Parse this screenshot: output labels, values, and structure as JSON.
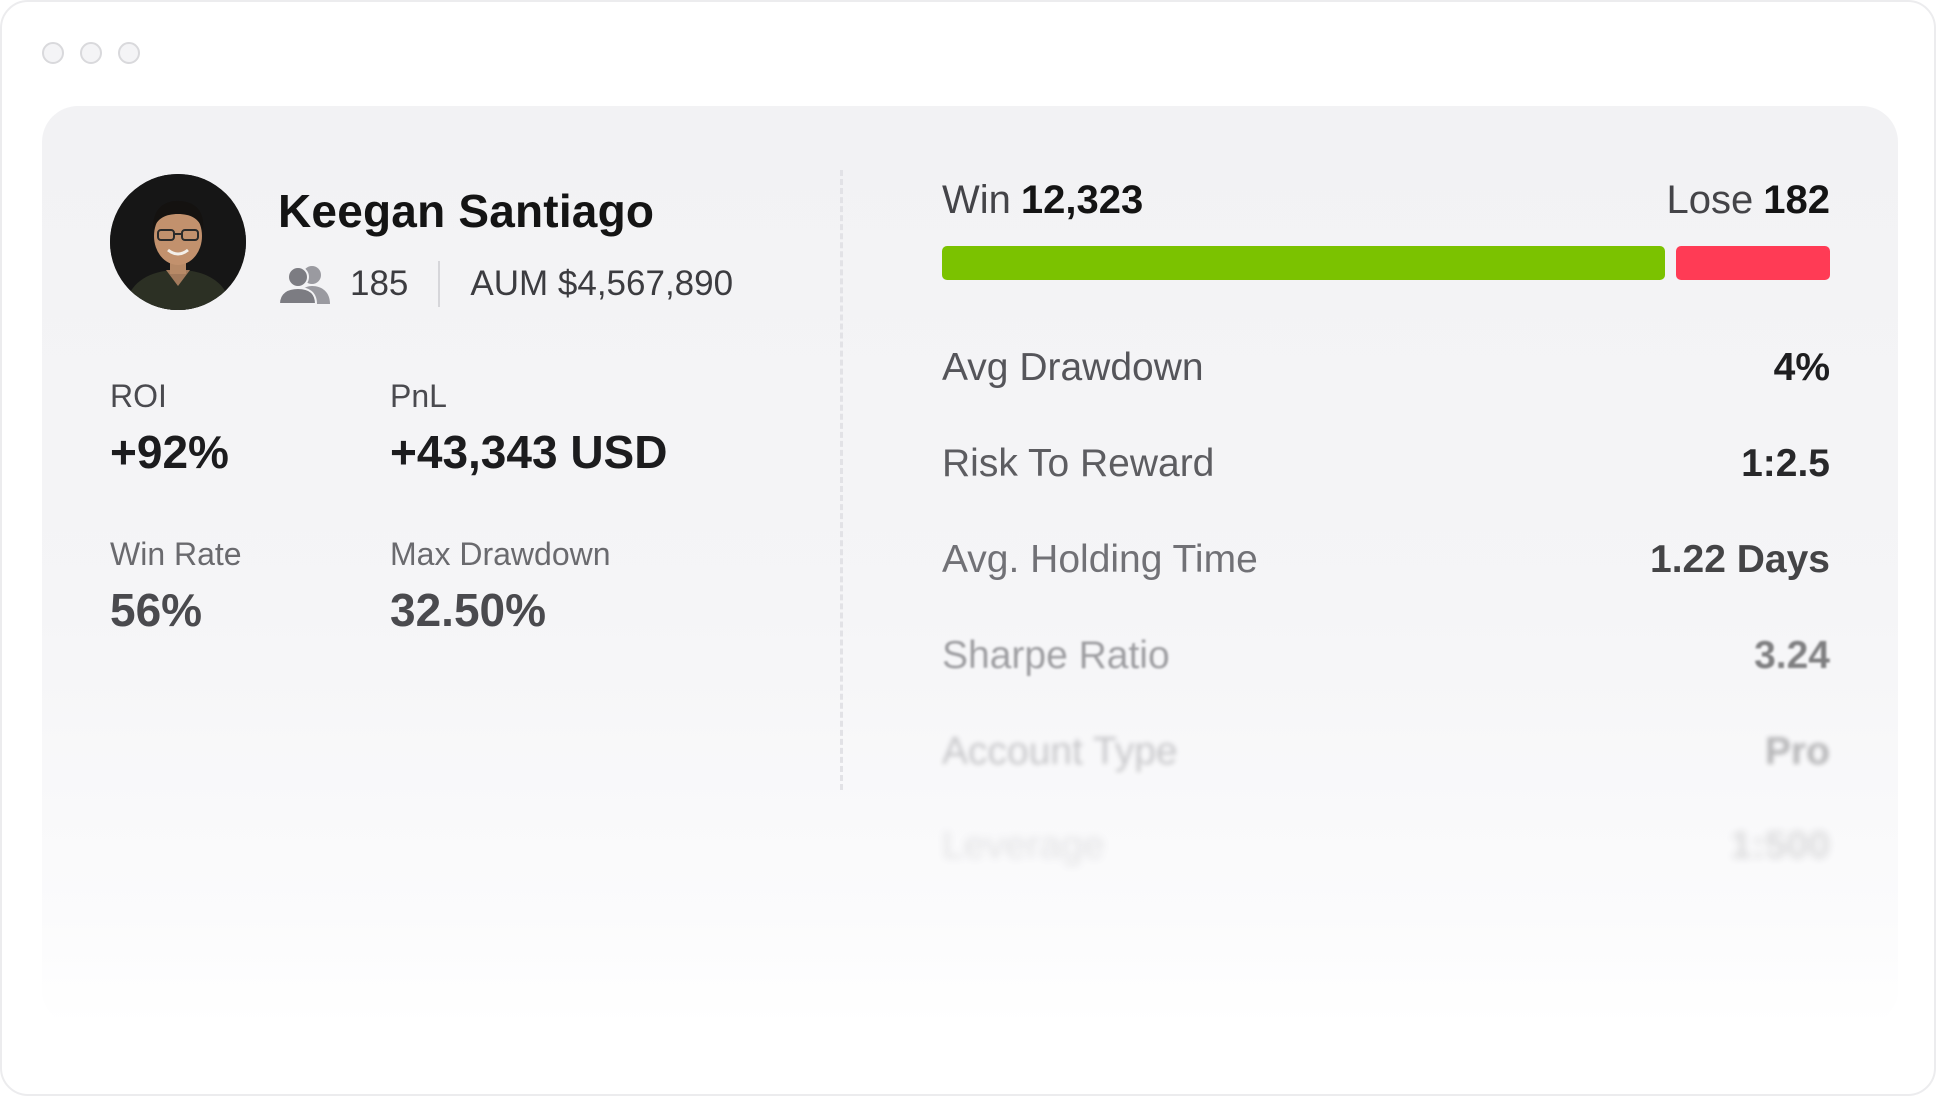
{
  "window": {
    "controls": [
      "close",
      "minimize",
      "maximize"
    ]
  },
  "profile": {
    "name": "Keegan Santiago",
    "followers": "185",
    "followers_icon": "users-icon",
    "aum": "AUM $4,567,890"
  },
  "stats": [
    {
      "label": "ROI",
      "value": "+92%"
    },
    {
      "label": "PnL",
      "value": "+43,343 USD"
    },
    {
      "label": "Win Rate",
      "value": "56%"
    },
    {
      "label": "Max Drawdown",
      "value": "32.50%"
    }
  ],
  "win_lose": {
    "win_label": "Win",
    "win_value": "12,323",
    "lose_label": "Lose",
    "lose_value": "182",
    "win_count": 12323,
    "lose_count": 182,
    "win_color": "#7bc200",
    "lose_color": "#ff3b55"
  },
  "metrics": [
    {
      "label": "Avg Drawdown",
      "value": "4%"
    },
    {
      "label": "Risk To Reward",
      "value": "1:2.5"
    },
    {
      "label": "Avg. Holding Time",
      "value": "1.22 Days"
    },
    {
      "label": "Sharpe Ratio",
      "value": "3.24"
    },
    {
      "label": "Account Type",
      "value": "Pro"
    },
    {
      "label": "Leverage",
      "value": "1:500"
    }
  ]
}
